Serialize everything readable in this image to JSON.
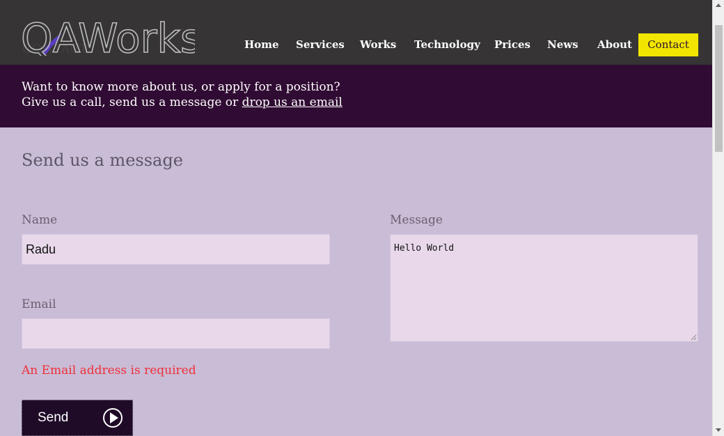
{
  "header": {
    "logo_text": "QAWorks",
    "logo_icon": "qaworks-logo-icon"
  },
  "nav": {
    "items": [
      {
        "label": "Home"
      },
      {
        "label": "Services"
      },
      {
        "label": "Works"
      },
      {
        "label": "Technology"
      },
      {
        "label": "Prices"
      },
      {
        "label": "News"
      },
      {
        "label": "About"
      },
      {
        "label": "Contact",
        "active": true
      }
    ]
  },
  "intro": {
    "line1": "Want to know more about us, or apply for a position?",
    "line2_prefix": "Give us a call, send us a message or ",
    "line2_link": "drop us an email"
  },
  "form": {
    "title": "Send us a message",
    "name_label": "Name",
    "name_value": "Radu",
    "email_label": "Email",
    "email_value": "",
    "message_label": "Message",
    "message_value": "Hello World",
    "error_text": "An Email address is required",
    "send_label": "Send",
    "send_icon": "play-circle-icon"
  },
  "colors": {
    "header_bg": "#363435",
    "banner_bg": "#300b33",
    "page_bg": "#c9bcd6",
    "field_bg": "#e8d8ea",
    "contact_accent": "#f2e600",
    "error": "#f0303a",
    "button_bg": "#1f0b28"
  }
}
